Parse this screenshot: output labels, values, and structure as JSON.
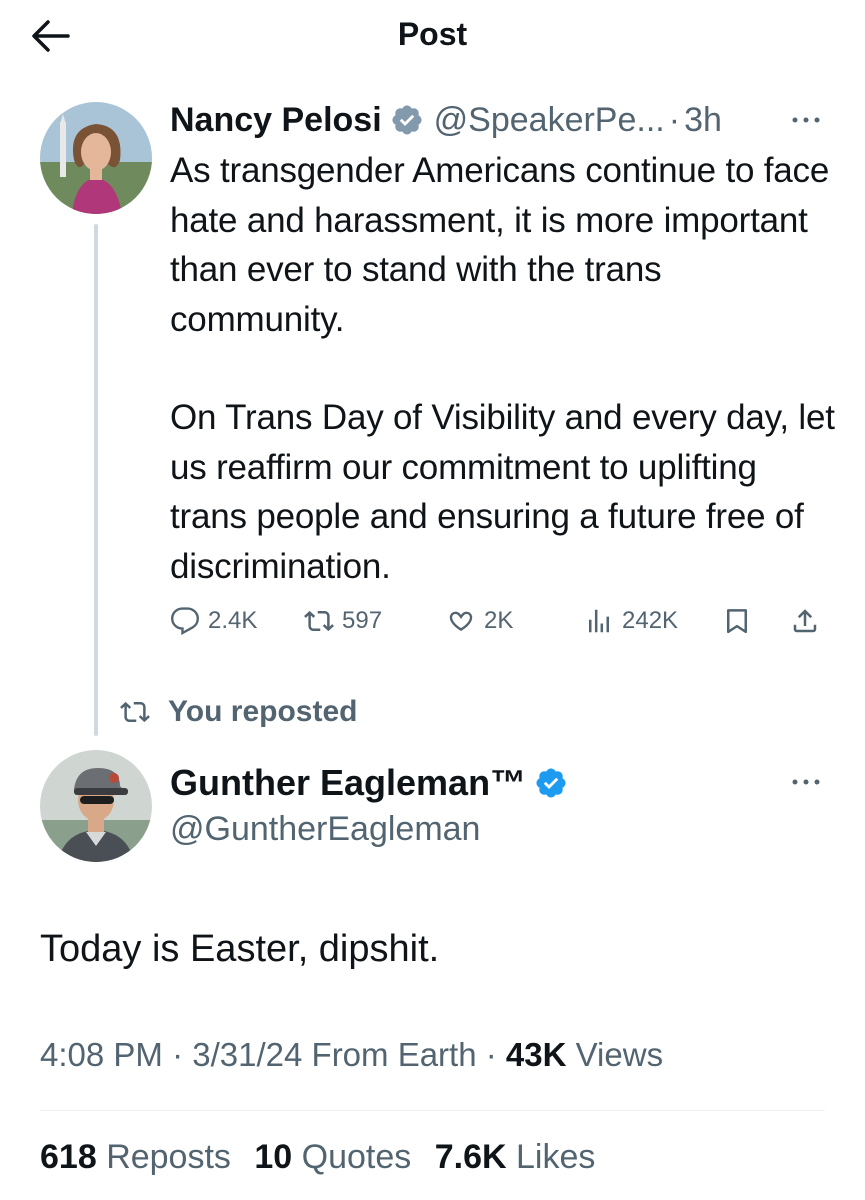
{
  "header": {
    "title": "Post"
  },
  "original_post": {
    "author_name": "Nancy Pelosi",
    "handle": "@SpeakerPe...",
    "separator": "·",
    "time": "3h",
    "paragraph_1": "As transgender Americans continue to face hate and harassment, it is more important than ever to stand with the trans community.",
    "paragraph_2": "On Trans Day of Visibility and every day, let us reaffirm our commitment to uplifting trans people and ensuring a future free of discrimination.",
    "metrics": {
      "replies": "2.4K",
      "reposts": "597",
      "likes": "2K",
      "views": "242K"
    }
  },
  "repost_label": "You reposted",
  "reply_post": {
    "author_name": "Gunther Eagleman™",
    "handle": "@GuntherEagleman",
    "text": "Today is Easter, dipshit.",
    "meta": {
      "time": "4:08 PM",
      "date": "3/31/24",
      "source": "From Earth",
      "views_count": "43K",
      "views_label": "Views",
      "separator": "·"
    },
    "stats": {
      "reposts_count": "618",
      "reposts_label": "Reposts",
      "quotes_count": "10",
      "quotes_label": "Quotes",
      "likes_count": "7.6K",
      "likes_label": "Likes"
    }
  },
  "colors": {
    "verified_blue": "#1d9bf0",
    "verified_gray": "#829aab",
    "secondary_text": "#536471",
    "primary_text": "#0f1419"
  }
}
